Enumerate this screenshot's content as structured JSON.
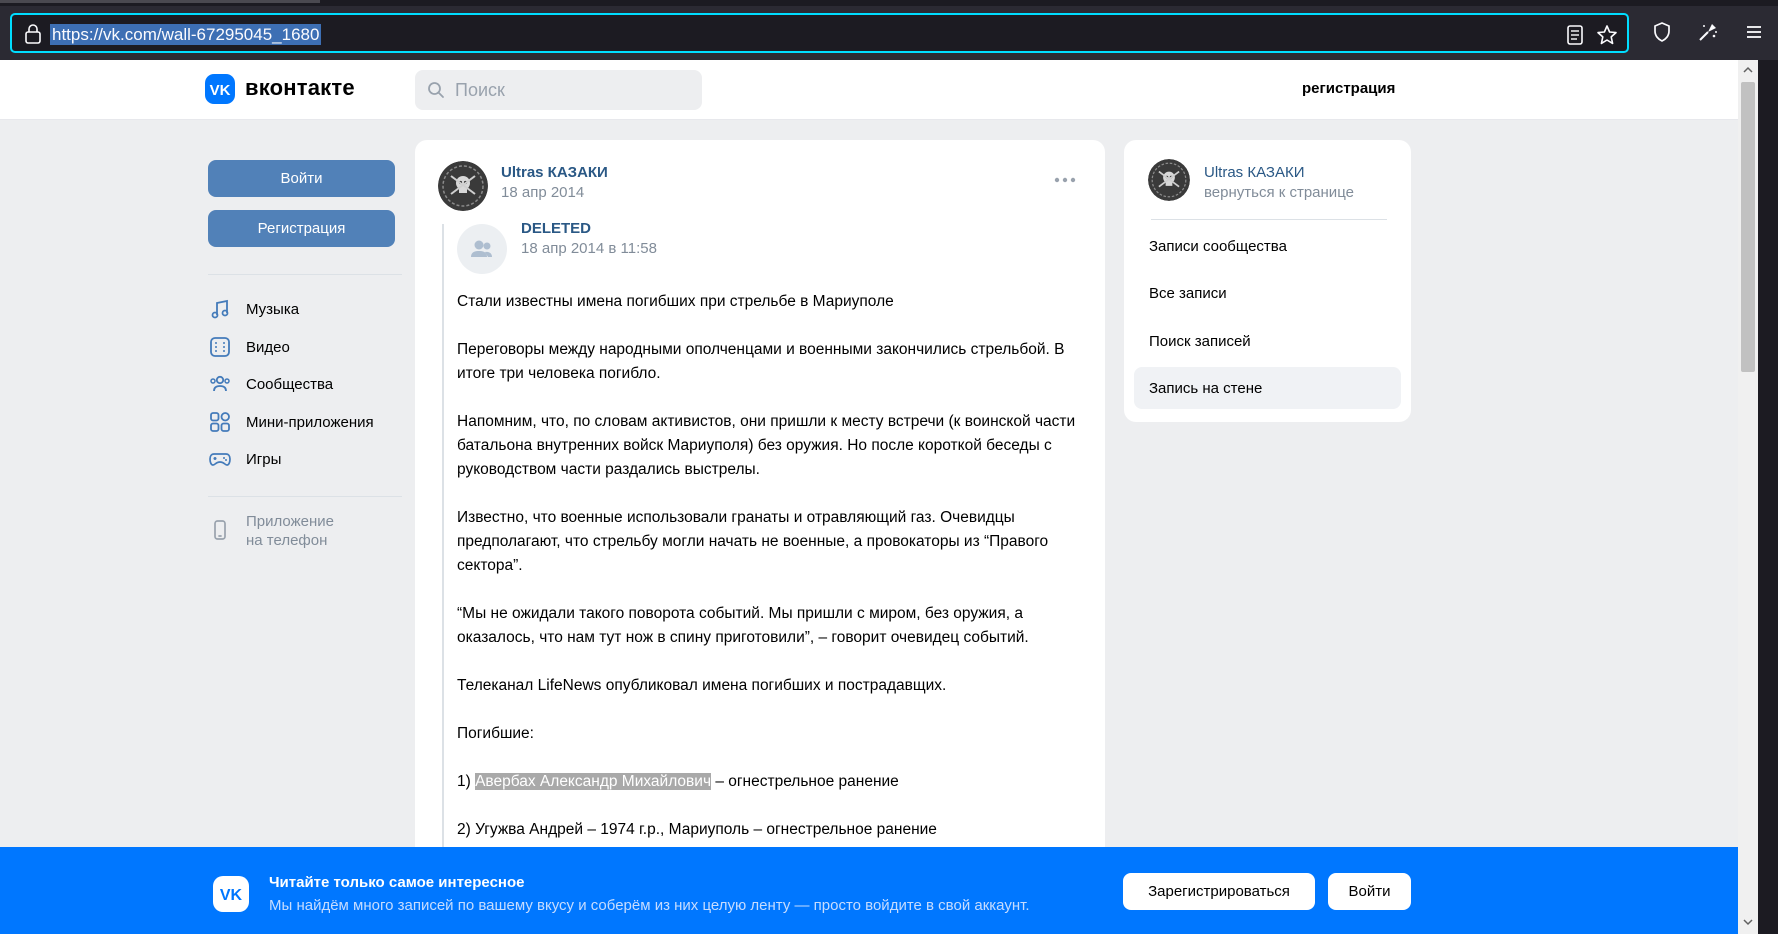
{
  "browser": {
    "url": "https://vk.com/wall-67295045_1680"
  },
  "header": {
    "logo_text": "вконтакте",
    "search_placeholder": "Поиск",
    "register_link": "регистрация"
  },
  "left_menu": {
    "login_label": "Войти",
    "register_label": "Регистрация",
    "items": [
      {
        "label": "Музыка",
        "icon": "music-icon"
      },
      {
        "label": "Видео",
        "icon": "video-icon"
      },
      {
        "label": "Сообщества",
        "icon": "communities-icon"
      },
      {
        "label": "Мини-приложения",
        "icon": "mini-apps-icon"
      },
      {
        "label": "Игры",
        "icon": "games-icon"
      }
    ],
    "app_label_1": "Приложение",
    "app_label_2": "на телефон"
  },
  "post": {
    "author": "Ultras КАЗАКИ",
    "date": "18 апр 2014",
    "repost_author": "DELETED",
    "repost_date": "18 апр 2014 в 11:58",
    "paragraphs": [
      "Стали известны имена погибших при стрельбе в Мариуполе",
      "Переговоры между народными ополченцами и военными закончились стрельбой. В итоге три человека погибло.",
      "Напомним, что, по словам активистов, они пришли к месту встречи (к воинской части батальона внутренних войск Мариуполя) без оружия. Но после короткой беседы с руководством части раздались выстрелы.",
      "Известно, что военные использовали гранаты и отравляющий газ. Очевидцы предполагают, что стрельбу могли начать не военные, а провокаторы из “Правого сектора”.",
      "“Мы не ожидали такого поворота событий. Мы пришли с миром, без оружия, а оказалось, что нам тут нож в спину приготовили”, – говорит очевидец событий.",
      "Телеканал LifeNews опубликовал имена погибших и пострадавщих.",
      "Погибшие:"
    ],
    "victim1_prefix": "1) ",
    "victim1_name": "Авербах Александр Михайлович",
    "victim1_suffix": " – огнестрельное ранение",
    "victim2": "2) Угужва Андрей – 1974 г.р., Мариуполь – огнестрельное ранение"
  },
  "side_card": {
    "group_name": "Ultras КАЗАКИ",
    "back_link": "вернуться к странице",
    "items": [
      {
        "label": "Записи сообщества"
      },
      {
        "label": "Все записи"
      },
      {
        "label": "Поиск записей"
      },
      {
        "label": "Запись на стене"
      }
    ]
  },
  "banner": {
    "title": "Читайте только самое интересное",
    "subtitle": "Мы найдём много записей по вашему вкусу и соберём из них целую ленту — просто войдите в свой аккаунт.",
    "register_button": "Зарегистрироваться",
    "login_button": "Войти"
  },
  "colors": {
    "vk_blue": "#0077ff",
    "button_blue": "#5181b8",
    "link_blue": "#2a5885",
    "gray_text": "#818c99"
  }
}
